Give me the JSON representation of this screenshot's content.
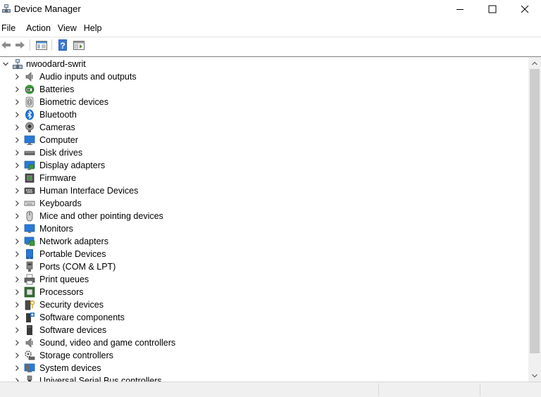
{
  "window": {
    "title": "Device Manager",
    "controls": [
      "minimize",
      "maximize",
      "close"
    ]
  },
  "menu": [
    "File",
    "Action",
    "View",
    "Help"
  ],
  "toolbar": {
    "buttons": [
      "back-arrow-icon",
      "forward-arrow-icon",
      "properties-icon",
      "help-icon",
      "show-hidden-icon"
    ]
  },
  "tree": {
    "root": "nwoodard-swrit",
    "nodes": [
      {
        "label": "Audio inputs and outputs",
        "icon": "speaker-icon"
      },
      {
        "label": "Batteries",
        "icon": "battery-icon"
      },
      {
        "label": "Biometric devices",
        "icon": "fingerprint-icon"
      },
      {
        "label": "Bluetooth",
        "icon": "bluetooth-icon"
      },
      {
        "label": "Cameras",
        "icon": "camera-icon"
      },
      {
        "label": "Computer",
        "icon": "computer-icon"
      },
      {
        "label": "Disk drives",
        "icon": "disk-drive-icon"
      },
      {
        "label": "Display adapters",
        "icon": "display-adapter-icon"
      },
      {
        "label": "Firmware",
        "icon": "firmware-icon"
      },
      {
        "label": "Human Interface Devices",
        "icon": "hid-icon"
      },
      {
        "label": "Keyboards",
        "icon": "keyboard-icon"
      },
      {
        "label": "Mice and other pointing devices",
        "icon": "mouse-icon"
      },
      {
        "label": "Monitors",
        "icon": "monitor-icon"
      },
      {
        "label": "Network adapters",
        "icon": "network-adapter-icon"
      },
      {
        "label": "Portable Devices",
        "icon": "portable-device-icon"
      },
      {
        "label": "Ports (COM & LPT)",
        "icon": "port-icon"
      },
      {
        "label": "Print queues",
        "icon": "printer-icon"
      },
      {
        "label": "Processors",
        "icon": "processor-icon"
      },
      {
        "label": "Security devices",
        "icon": "security-device-icon"
      },
      {
        "label": "Software components",
        "icon": "software-component-icon"
      },
      {
        "label": "Software devices",
        "icon": "software-device-icon"
      },
      {
        "label": "Sound, video and game controllers",
        "icon": "sound-controller-icon"
      },
      {
        "label": "Storage controllers",
        "icon": "storage-controller-icon"
      },
      {
        "label": "System devices",
        "icon": "system-device-icon"
      },
      {
        "label": "Universal Serial Bus controllers",
        "icon": "usb-controller-icon"
      }
    ]
  },
  "colors": {
    "accent_blue": "#2b79d6",
    "window_bg": "#ffffff",
    "status_bg": "#f0f0f0"
  }
}
